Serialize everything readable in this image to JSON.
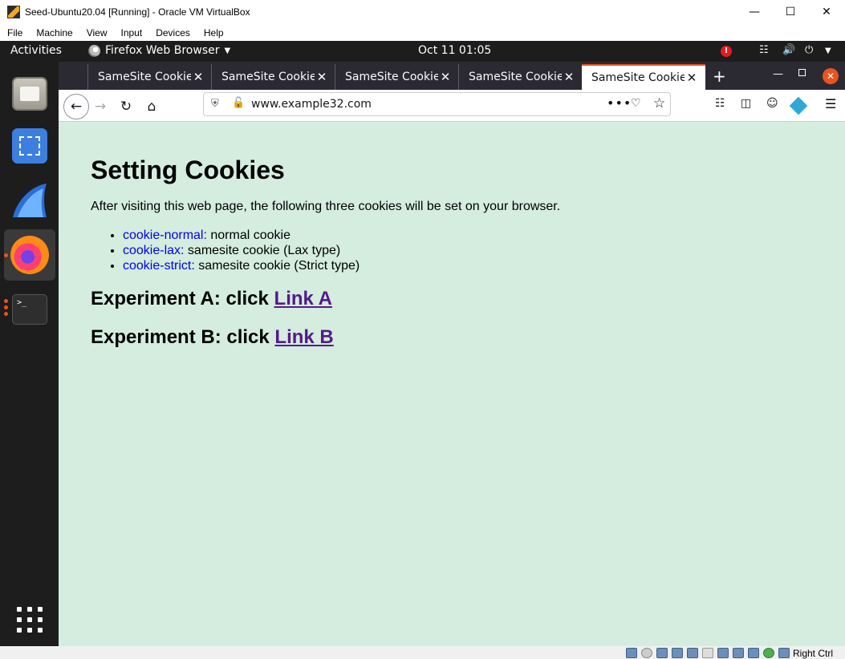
{
  "vbox": {
    "title": "Seed-Ubuntu20.04 [Running] - Oracle VM VirtualBox",
    "menu": [
      "File",
      "Machine",
      "View",
      "Input",
      "Devices",
      "Help"
    ],
    "status_key": "Right Ctrl"
  },
  "gnome": {
    "activities": "Activities",
    "app_name": "Firefox Web Browser",
    "clock": "Oct 11  01:05",
    "alert": "!"
  },
  "firefox": {
    "tabs": [
      {
        "title": "SameSite Cookie",
        "selected": false
      },
      {
        "title": "SameSite Cookie",
        "selected": false
      },
      {
        "title": "SameSite Cookie",
        "selected": false
      },
      {
        "title": "SameSite Cookie",
        "selected": false
      },
      {
        "title": "SameSite Cookie",
        "selected": true
      }
    ],
    "url": "www.example32.com"
  },
  "page": {
    "title": "Setting Cookies",
    "intro": "After visiting this web page, the following three cookies will be set on your browser.",
    "cookies": [
      {
        "name": "cookie-normal:",
        "desc": " normal cookie"
      },
      {
        "name": "cookie-lax:",
        "desc": " samesite cookie (Lax type)"
      },
      {
        "name": "cookie-strict:",
        "desc": " samesite cookie (Strict type)"
      }
    ],
    "experiment_a": {
      "prefix": "Experiment A: click ",
      "link": "Link A"
    },
    "experiment_b": {
      "prefix": "Experiment B: click ",
      "link": "Link B"
    }
  },
  "colors": {
    "page_bg": "#d4eddf",
    "ubuntu_orange": "#e95420",
    "link": "#0000ee",
    "visited_link": "#551a8b"
  }
}
